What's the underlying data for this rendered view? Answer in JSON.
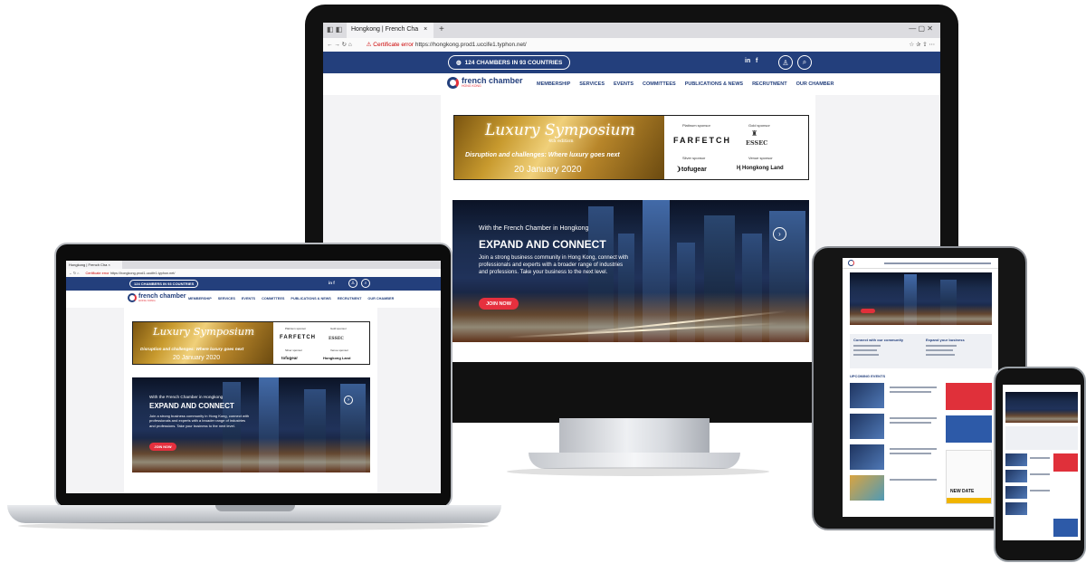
{
  "desktop": {
    "tab_title": "Hongkong | French Cha",
    "address_warning": "Certificate error",
    "address_url": "https://hongkong.prod1.uccife1.typhon.net/",
    "chambers_label": "124 CHAMBERS IN 93 COUNTRIES",
    "social": [
      "in",
      "f"
    ],
    "logo_text": "french chamber",
    "logo_sub": "HONG KONG",
    "nav": [
      "MEMBERSHIP",
      "SERVICES",
      "EVENTS",
      "COMMITTEES",
      "PUBLICATIONS & NEWS",
      "RECRUTMENT",
      "OUR CHAMBER"
    ],
    "banner": {
      "title": "Luxury Symposium",
      "edition": "4th edition",
      "tagline": "Disruption and challenges: Where luxury goes next",
      "date": "20 January 2020",
      "platinum_label": "Platinum sponsor",
      "platinum_name": "FARFETCH",
      "gold_label": "Gold sponsor",
      "gold_name": "ESSEC",
      "silver_label": "Silver sponsor",
      "silver_name": "tofugear",
      "venue_label": "Venue sponsor",
      "venue_name": "Hongkong Land"
    },
    "hero": {
      "kicker": "With the French Chamber in Hongkong",
      "title": "EXPAND AND CONNECT",
      "body": "Join a strong business community in Hong Kong, connect with professionals and experts with a broader range of industries and professions. Take your business to the next level.",
      "cta": "JOIN NOW"
    }
  },
  "laptop": {
    "tab_title": "Hongkong | French Cha",
    "address_warning": "Certificate error",
    "address_url": "https://hongkong.prod1.uccife1.typhon.net/"
  },
  "tablet": {
    "connect_title": "Connect with our community",
    "expand_title": "Expand your business",
    "upcoming_title": "UPCOMING EVENTS",
    "new_date": "NEW DATE"
  },
  "colors": {
    "brand_blue": "#233f7c",
    "brand_red": "#e5323b",
    "cta_red": "#e6303e"
  }
}
